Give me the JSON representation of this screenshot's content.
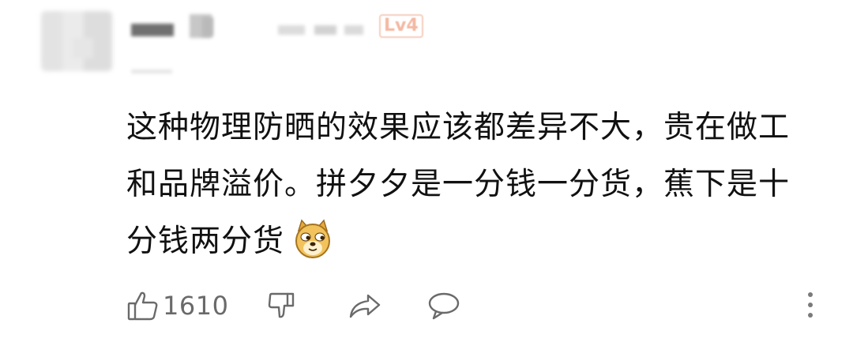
{
  "comment": {
    "level_badge": "Lv4",
    "text_lines": [
      "这种物理防晒的效果应该都差异不大，贵在做工",
      "和品牌溢价。拼夕夕是一分钱一分货，蕉下是十",
      "分钱两分货"
    ],
    "emoji": "doge-emoji",
    "like_count": "1610"
  },
  "icons": {
    "like": "thumbs-up-icon",
    "dislike": "thumbs-down-icon",
    "share": "share-arrow-icon",
    "reply": "speech-bubble-icon",
    "more": "vertical-dots-icon"
  },
  "colors": {
    "text": "#111111",
    "icon": "#666666",
    "badge": "#f3b8a2"
  }
}
